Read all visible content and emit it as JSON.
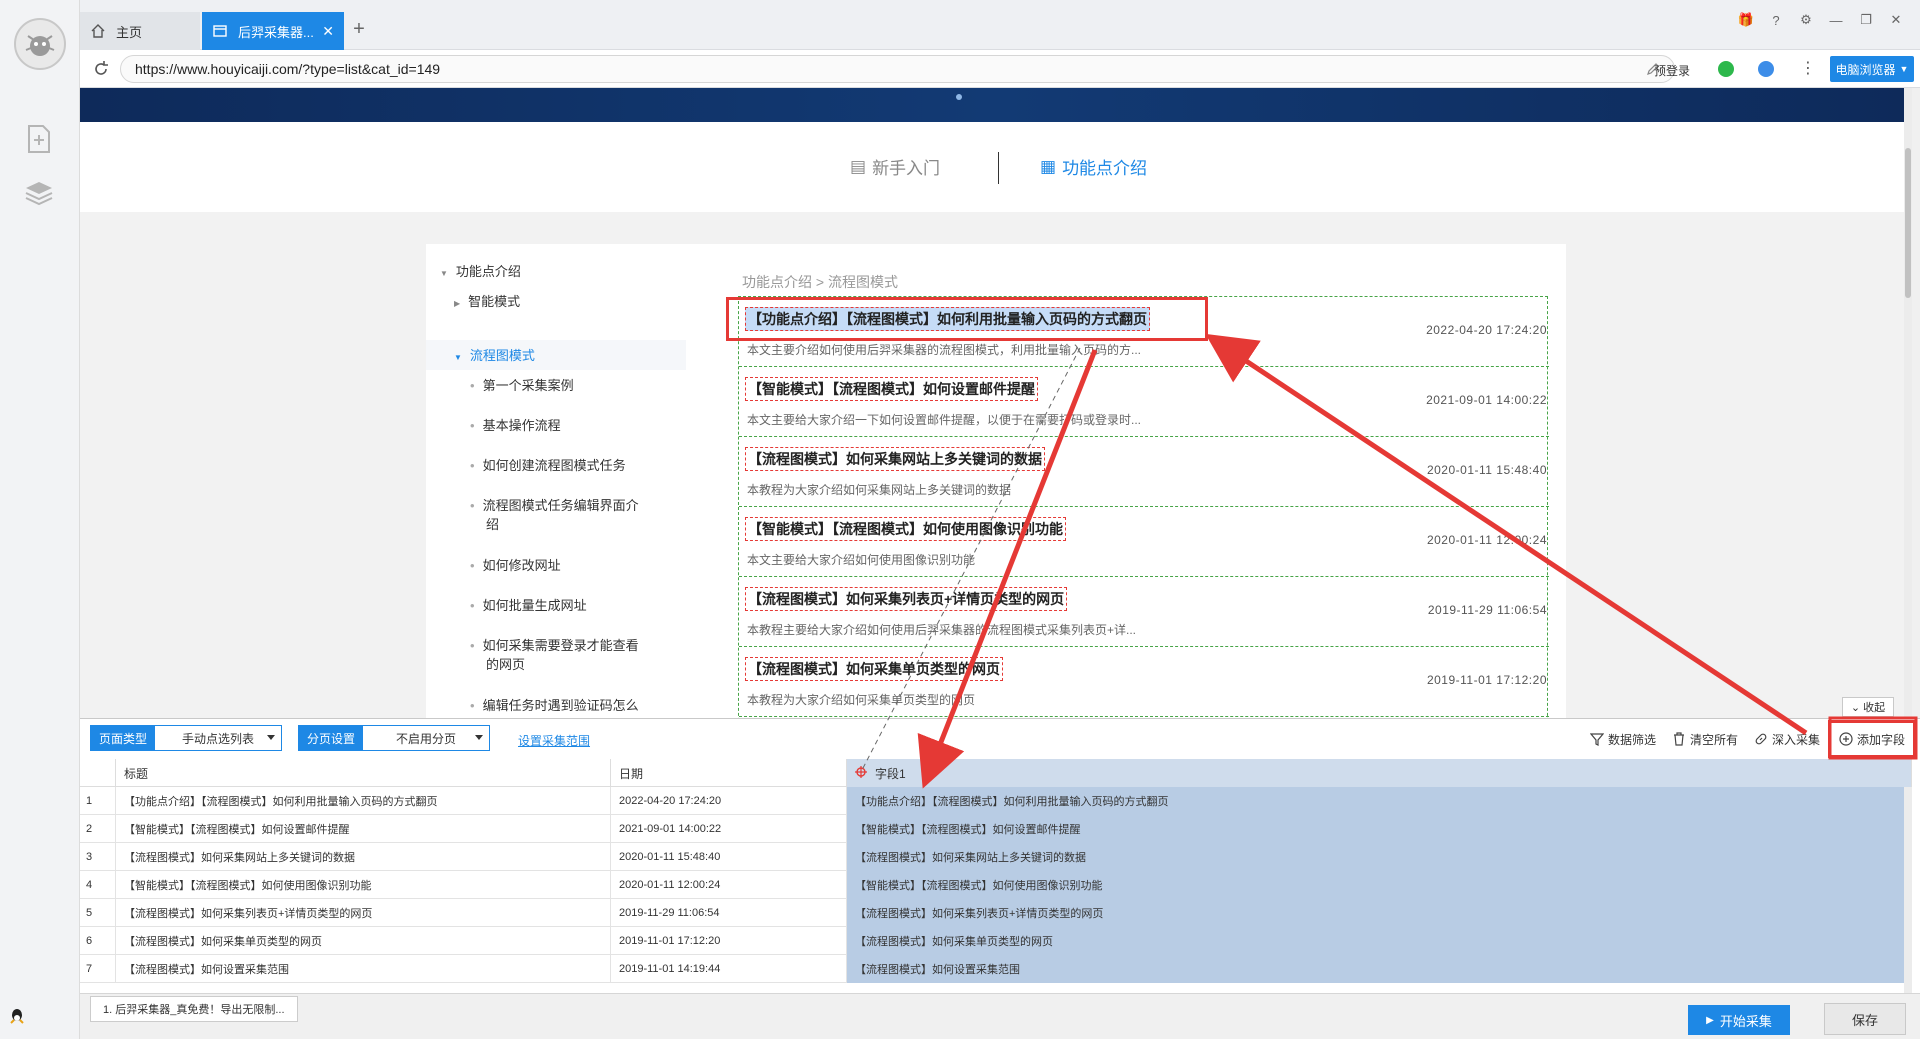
{
  "tabs": [
    {
      "label": "主页"
    },
    {
      "label": "后羿采集器..."
    }
  ],
  "address": {
    "url": "https://www.houyicaiji.com/?type=list&cat_id=149",
    "pre_login": "预登录",
    "browser_label": "电脑浏览器"
  },
  "site_nav": {
    "item_a": "新手入门",
    "item_b": "功能点介绍"
  },
  "left_nav": {
    "root": "功能点介绍",
    "smart": "智能模式",
    "flow": "流程图模式",
    "children": [
      "第一个采集案例",
      "基本操作流程",
      "如何创建流程图模式任务",
      "流程图模式任务编辑界面介",
      "绍",
      "如何修改网址",
      "如何批量生成网址",
      "如何采集需要登录才能查看",
      "的网页",
      "编辑任务时遇到验证码怎么"
    ]
  },
  "breadcrumb": "功能点介绍 > 流程图模式",
  "articles": [
    {
      "title": "【功能点介绍】【流程图模式】如何利用批量输入页码的方式翻页",
      "date": "2022-04-20 17:24:20",
      "desc": "本文主要介绍如何使用后羿采集器的流程图模式，利用批量输入页码的方..."
    },
    {
      "title": "【智能模式】【流程图模式】如何设置邮件提醒",
      "date": "2021-09-01 14:00:22",
      "desc": "本文主要给大家介绍一下如何设置邮件提醒，以便于在需要打码或登录时..."
    },
    {
      "title": "【流程图模式】如何采集网站上多关键词的数据",
      "date": "2020-01-11 15:48:40",
      "desc": "本教程为大家介绍如何采集网站上多关键词的数据"
    },
    {
      "title": "【智能模式】【流程图模式】如何使用图像识别功能",
      "date": "2020-01-11 12:00:24",
      "desc": "本文主要给大家介绍如何使用图像识别功能"
    },
    {
      "title": "【流程图模式】如何采集列表页+详情页类型的网页",
      "date": "2019-11-29 11:06:54",
      "desc": "本教程主要给大家介绍如何使用后羿采集器的流程图模式采集列表页+详..."
    },
    {
      "title": "【流程图模式】如何采集单页类型的网页",
      "date": "2019-11-01 17:12:20",
      "desc": "本教程为大家介绍如何采集单页类型的网页"
    }
  ],
  "toolbar": {
    "page_type_label": "页面类型",
    "page_type_value": "手动点选列表",
    "paging_label": "分页设置",
    "paging_value": "不启用分页",
    "range_link": "设置采集范围",
    "filter": "数据筛选",
    "clear": "清空所有",
    "deep": "深入采集",
    "add_field": "添加字段",
    "collapse": "收起"
  },
  "grid": {
    "headers": {
      "title": "标题",
      "date": "日期",
      "field1": "字段1"
    },
    "rows": [
      {
        "idx": "1",
        "title": "【功能点介绍】【流程图模式】如何利用批量输入页码的方式翻页",
        "date": "2022-04-20 17:24:20",
        "field1": "【功能点介绍】【流程图模式】如何利用批量输入页码的方式翻页"
      },
      {
        "idx": "2",
        "title": "【智能模式】【流程图模式】如何设置邮件提醒",
        "date": "2021-09-01 14:00:22",
        "field1": "【智能模式】【流程图模式】如何设置邮件提醒"
      },
      {
        "idx": "3",
        "title": "【流程图模式】如何采集网站上多关键词的数据",
        "date": "2020-01-11 15:48:40",
        "field1": "【流程图模式】如何采集网站上多关键词的数据"
      },
      {
        "idx": "4",
        "title": "【智能模式】【流程图模式】如何使用图像识别功能",
        "date": "2020-01-11 12:00:24",
        "field1": "【智能模式】【流程图模式】如何使用图像识别功能"
      },
      {
        "idx": "5",
        "title": "【流程图模式】如何采集列表页+详情页类型的网页",
        "date": "2019-11-29 11:06:54",
        "field1": "【流程图模式】如何采集列表页+详情页类型的网页"
      },
      {
        "idx": "6",
        "title": "【流程图模式】如何采集单页类型的网页",
        "date": "2019-11-01 17:12:20",
        "field1": "【流程图模式】如何采集单页类型的网页"
      },
      {
        "idx": "7",
        "title": "【流程图模式】如何设置采集范围",
        "date": "2019-11-01 14:19:44",
        "field1": "【流程图模式】如何设置采集范围"
      }
    ]
  },
  "status": {
    "notice": "1. 后羿采集器_真免费！导出无限制...",
    "start": "开始采集",
    "save": "保存"
  },
  "colors": {
    "accent": "#1e88e5",
    "annotation_red": "#e53935",
    "selection_green": "#47a447",
    "field_column": "#b8cce4"
  }
}
